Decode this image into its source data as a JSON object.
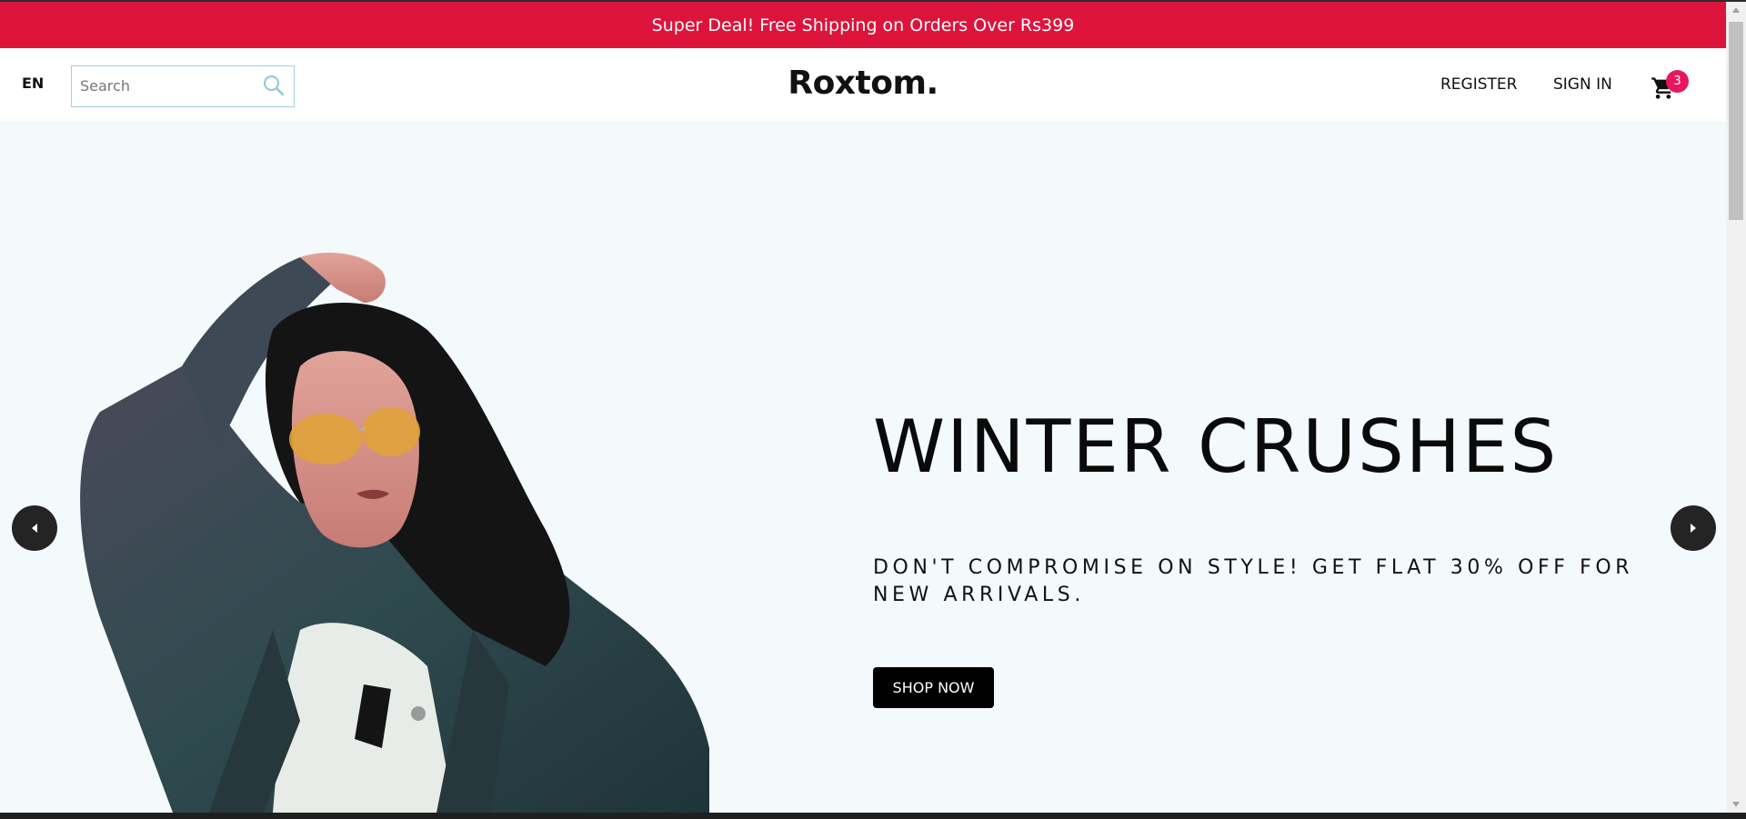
{
  "announcement": {
    "text": "Super Deal! Free Shipping on Orders Over Rs399"
  },
  "header": {
    "language": "EN",
    "search": {
      "placeholder": "Search",
      "value": "",
      "icon": "search-icon"
    },
    "logo": "Roxtom.",
    "nav": {
      "register": "REGISTER",
      "sign_in": "SIGN IN"
    },
    "cart": {
      "icon": "cart-icon",
      "count": "3"
    }
  },
  "hero": {
    "image": "woman-denim-jacket-sunglasses-photo",
    "title": "WINTER CRUSHES",
    "description": "DON'T COMPROMISE ON STYLE! GET FLAT 30% OFF FOR NEW ARRIVALS.",
    "cta": "SHOP NOW",
    "prev_icon": "arrow-left-icon",
    "next_icon": "arrow-right-icon"
  },
  "colors": {
    "announcement_bg": "#dc143c",
    "badge": "#e8175d",
    "hero_bg": "#f4f9fb",
    "search_border": "#9fcfda",
    "button": "#000000"
  }
}
